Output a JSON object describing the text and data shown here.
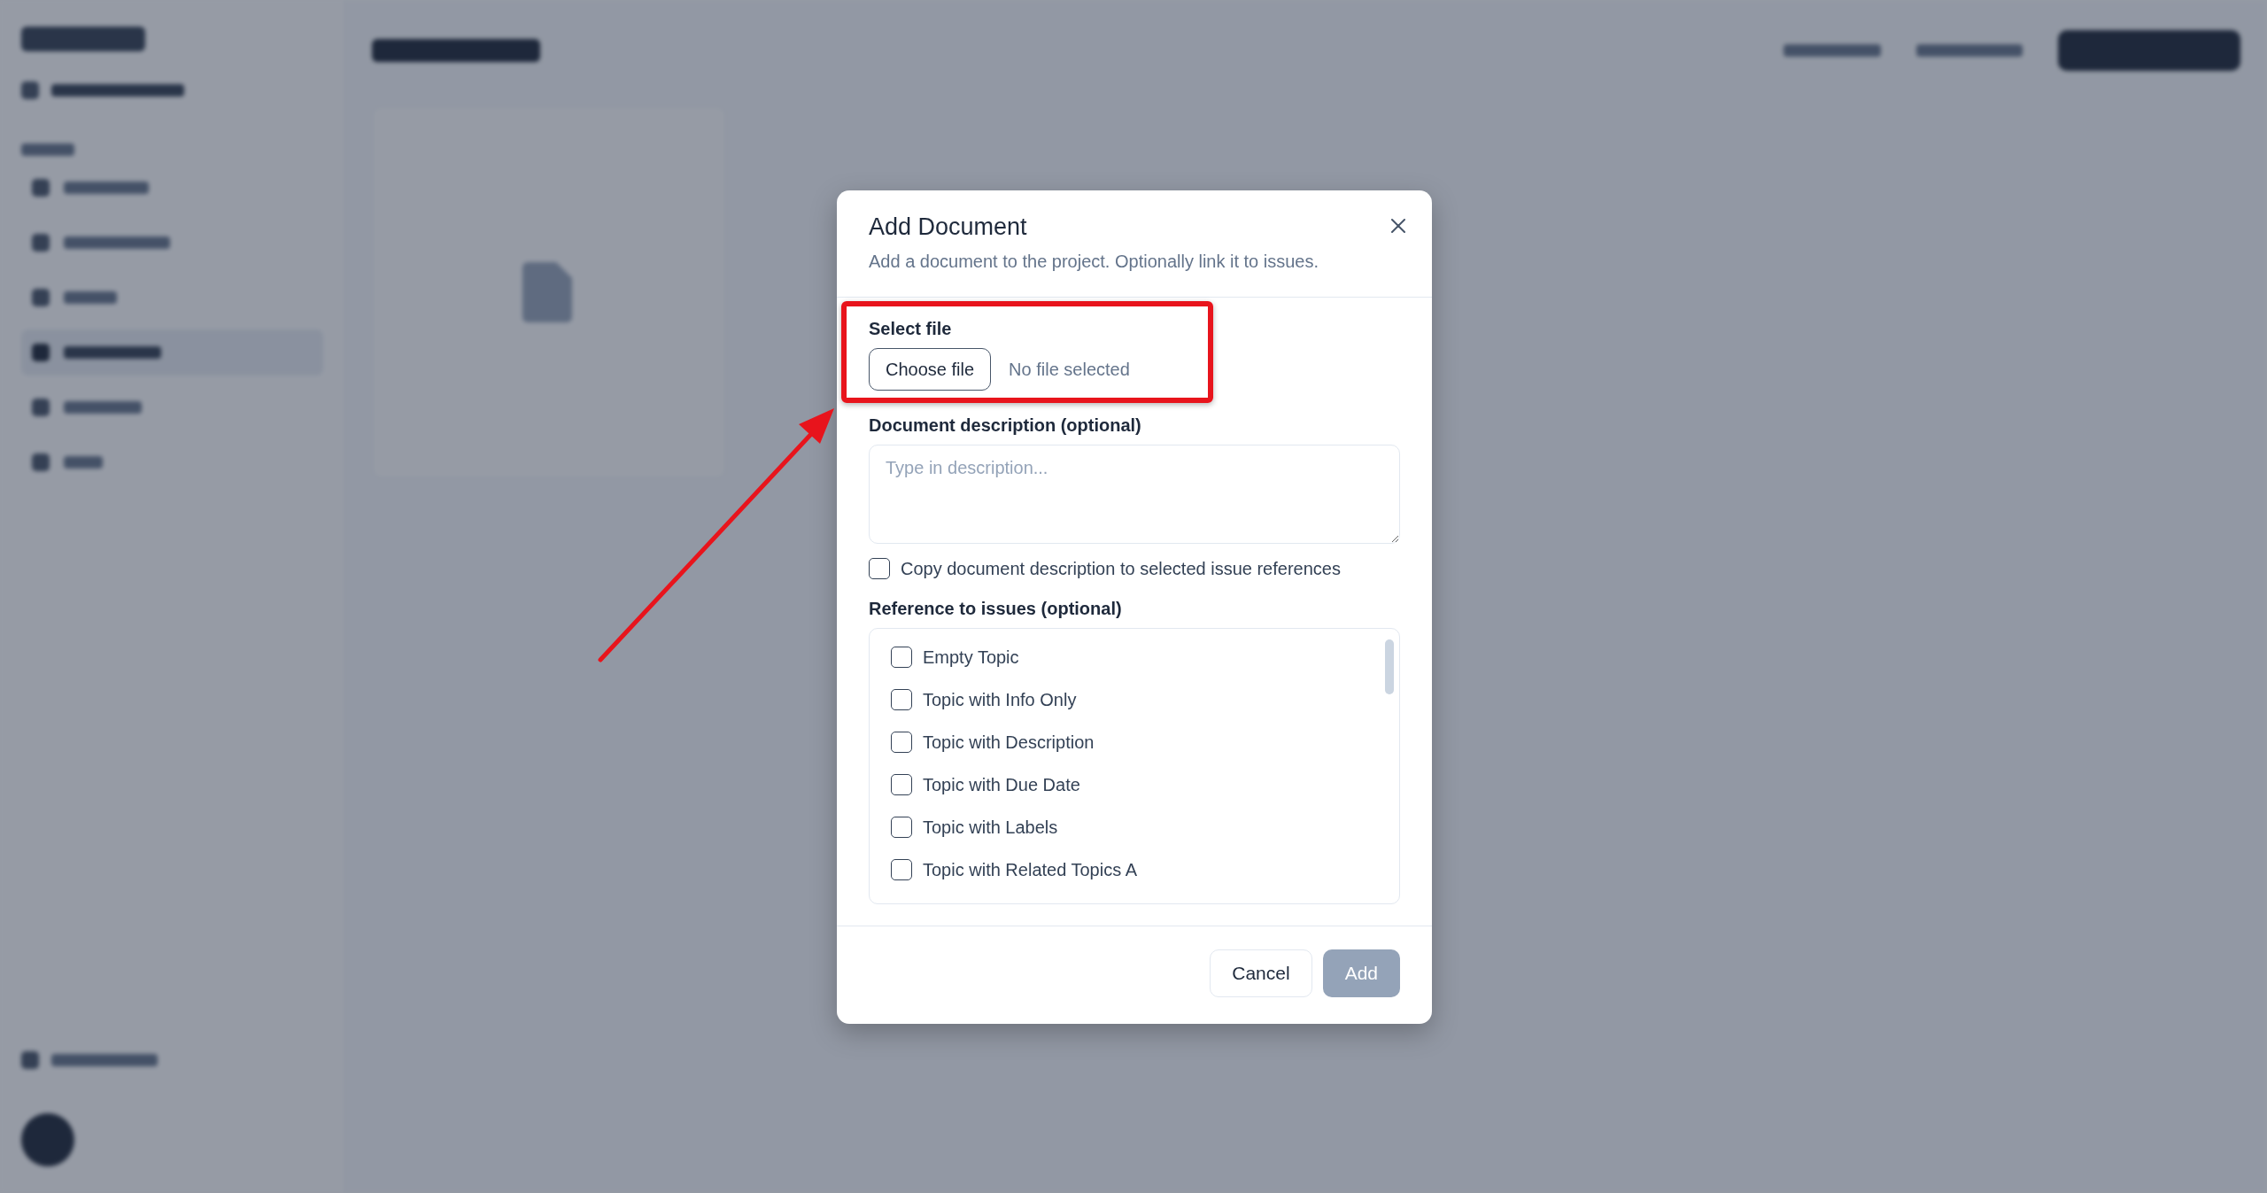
{
  "sidebar": {
    "items": [
      {
        "selected": false
      },
      {
        "selected": false
      },
      {
        "selected": false
      },
      {
        "selected": true
      },
      {
        "selected": false
      },
      {
        "selected": false
      }
    ]
  },
  "dialog": {
    "title": "Add Document",
    "description": "Add a document to the project. Optionally link it to issues.",
    "file": {
      "label": "Select file",
      "button": "Choose file",
      "status": "No file selected"
    },
    "description_field": {
      "label": "Document description (optional)",
      "placeholder": "Type in description..."
    },
    "copy_option": {
      "label": "Copy document description to selected issue references",
      "checked": false
    },
    "issues": {
      "label": "Reference to issues (optional)",
      "items": [
        {
          "label": "Empty Topic",
          "checked": false
        },
        {
          "label": "Topic with Info Only",
          "checked": false
        },
        {
          "label": "Topic with Description",
          "checked": false
        },
        {
          "label": "Topic with Due Date",
          "checked": false
        },
        {
          "label": "Topic with Labels",
          "checked": false
        },
        {
          "label": "Topic with Related Topics A",
          "checked": false
        }
      ]
    },
    "buttons": [
      {
        "label": "Cancel",
        "kind": "secondary",
        "disabled": false
      },
      {
        "label": "Add",
        "kind": "primary",
        "disabled": true
      }
    ]
  }
}
